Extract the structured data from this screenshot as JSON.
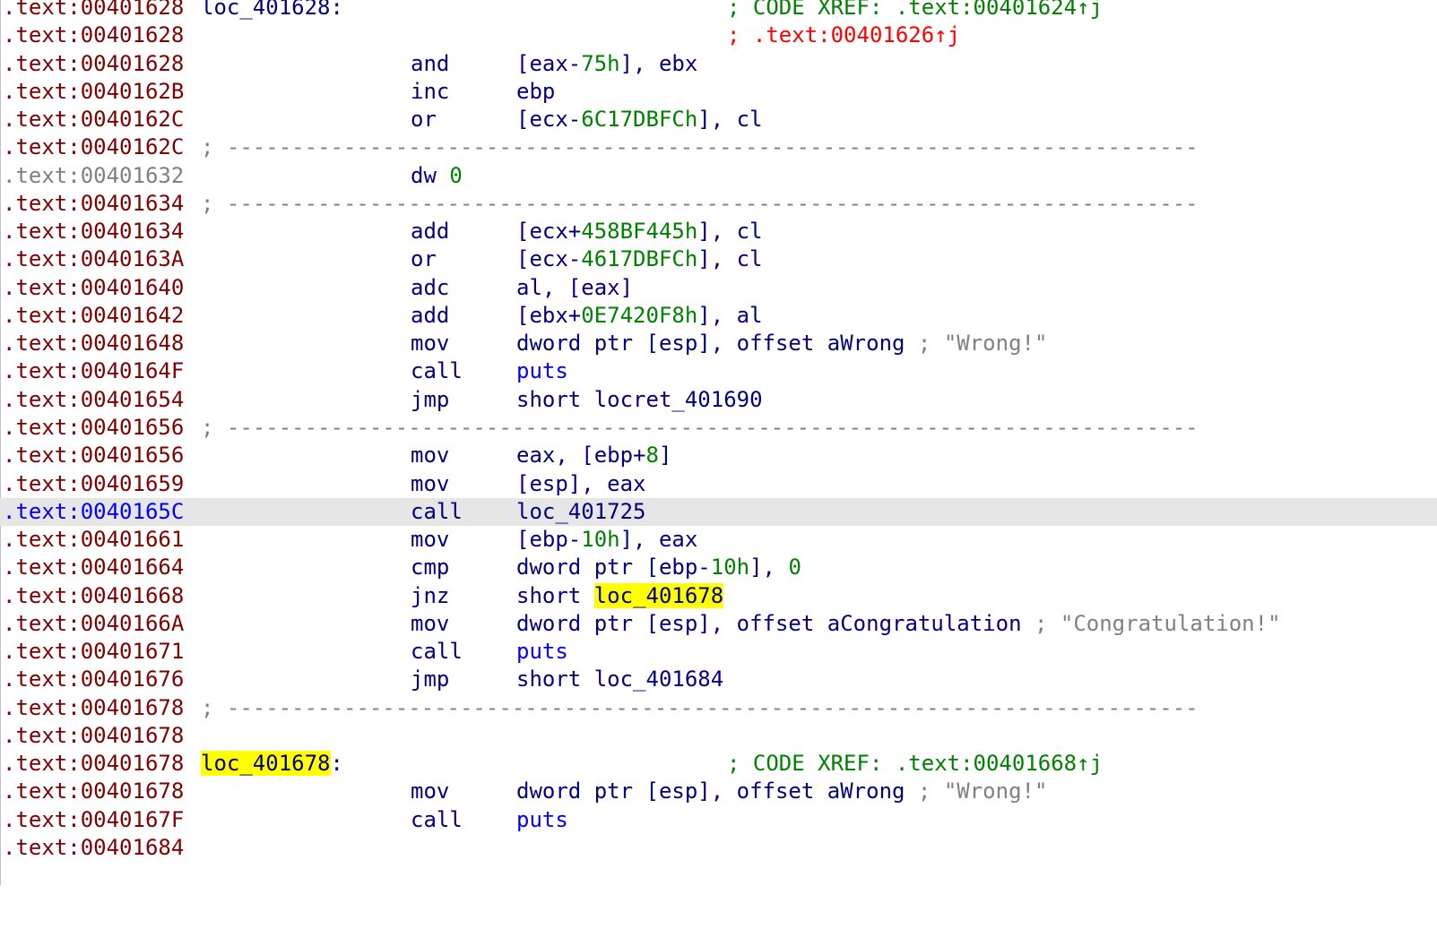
{
  "listing": {
    "lines": [
      {
        "addr": ".text:00401628",
        "label": "loc_401628",
        "label_colon": ":",
        "xref": "; CODE XREF: .text:00401624↑j"
      },
      {
        "addr": ".text:00401628",
        "xref": "; .text:00401626↑j"
      },
      {
        "addr": ".text:00401628",
        "mnem": "and",
        "op1": "[eax-",
        "op2": "75h",
        "op3": "], ebx"
      },
      {
        "addr": ".text:0040162B",
        "mnem": "inc",
        "op1": "ebp"
      },
      {
        "addr": ".text:0040162C",
        "mnem": "or",
        "op1": "[ecx-",
        "op2": "6C17DBFCh",
        "op3": "], cl"
      },
      {
        "addr": ".text:0040162C",
        "sep": "; ---------------------------------------------------------------------------"
      },
      {
        "addr": ".text:00401632",
        "mnem": "dw",
        "num": "0"
      },
      {
        "addr": ".text:00401634",
        "sep": "; ---------------------------------------------------------------------------"
      },
      {
        "addr": ".text:00401634",
        "mnem": "add",
        "op1": "[ecx+",
        "op2": "458BF445h",
        "op3": "], cl"
      },
      {
        "addr": ".text:0040163A",
        "mnem": "or",
        "op1": "[ecx-",
        "op2": "4617DBFCh",
        "op3": "], cl"
      },
      {
        "addr": ".text:00401640",
        "mnem": "adc",
        "op1": "al, [eax]"
      },
      {
        "addr": ".text:00401642",
        "mnem": "add",
        "op1": "[ebx+",
        "op2": "0E7420F8h",
        "op3": "], al"
      },
      {
        "addr": ".text:00401648",
        "mnem": "mov",
        "op1": "dword ptr [esp], offset aWrong",
        "comment": " ; \"Wrong!\""
      },
      {
        "addr": ".text:0040164F",
        "mnem": "call",
        "target": "puts"
      },
      {
        "addr": ".text:00401654",
        "mnem": "jmp",
        "op1": "short locret_401690"
      },
      {
        "addr": ".text:00401656",
        "sep": "; ---------------------------------------------------------------------------"
      },
      {
        "addr": ".text:00401656",
        "mnem": "mov",
        "op1": "eax, [ebp+",
        "op2": "8",
        "op3": "]"
      },
      {
        "addr": ".text:00401659",
        "mnem": "mov",
        "op1": "[esp], eax"
      },
      {
        "addr": ".text:0040165C",
        "mnem": "call",
        "op1": "loc_401725"
      },
      {
        "addr": ".text:00401661",
        "mnem": "mov",
        "op1": "[ebp-",
        "op2": "10h",
        "op3": "], eax"
      },
      {
        "addr": ".text:00401664",
        "mnem": "cmp",
        "op1": "dword ptr [ebp-",
        "op2": "10h",
        "op3": "], ",
        "op4": "0"
      },
      {
        "addr": ".text:00401668",
        "mnem": "jnz",
        "op1": "short ",
        "hl": "loc_401678"
      },
      {
        "addr": ".text:0040166A",
        "mnem": "mov",
        "op1": "dword ptr [esp], offset aCongratulation",
        "comment": " ; \"Congratulation!\""
      },
      {
        "addr": ".text:00401671",
        "mnem": "call",
        "target": "puts"
      },
      {
        "addr": ".text:00401676",
        "mnem": "jmp",
        "op1": "short loc_401684"
      },
      {
        "addr": ".text:00401678",
        "sep": "; ---------------------------------------------------------------------------"
      },
      {
        "addr": ".text:00401678"
      },
      {
        "addr": ".text:00401678",
        "label": "loc_401678",
        "label_colon": ":",
        "xref": "; CODE XREF: .text:00401668↑j"
      },
      {
        "addr": ".text:00401678",
        "mnem": "mov",
        "op1": "dword ptr [esp], offset aWrong",
        "comment": " ; \"Wrong!\""
      },
      {
        "addr": ".text:0040167F",
        "mnem": "call",
        "target": "puts"
      },
      {
        "addr": ".text:00401684"
      }
    ]
  }
}
